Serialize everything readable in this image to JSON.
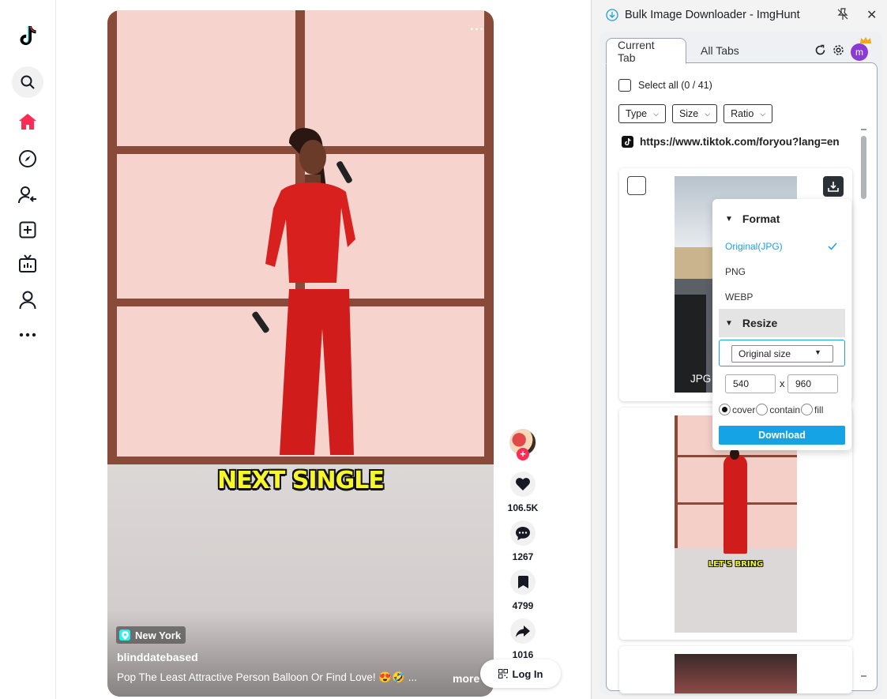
{
  "nav": {
    "items": [
      {
        "name": "tiktok-logo-icon"
      },
      {
        "name": "search-icon"
      },
      {
        "name": "home-icon"
      },
      {
        "name": "explore-icon"
      },
      {
        "name": "following-icon"
      },
      {
        "name": "upload-icon"
      },
      {
        "name": "live-icon"
      },
      {
        "name": "profile-icon"
      },
      {
        "name": "more-icon"
      }
    ],
    "accent": "#fe2c55"
  },
  "video": {
    "caption": "NEXT SINGLE",
    "location": "New York",
    "author": "blinddatebased",
    "description": "Pop The Least Attractive Person Balloon Or Find Love! 😍🤣 ...",
    "more_label": "more",
    "menu_glyph": "···"
  },
  "actions": {
    "likes": "106.5K",
    "comments": "1267",
    "saves": "4799",
    "shares": "1016"
  },
  "login": {
    "label": "Log In"
  },
  "extension": {
    "title": "Bulk Image Downloader - ImgHunt",
    "tabs": [
      "Current Tab",
      "All Tabs"
    ],
    "user_initial": "m",
    "select_all": "Select all (0 / 41)",
    "filters": [
      "Type",
      "Size",
      "Ratio"
    ],
    "url": "https://www.tiktok.com/foryou?lang=en",
    "image_type": "JPG",
    "thumb2_caption": "LET'S BRING",
    "popup": {
      "format_label": "Format",
      "formats": [
        "Original(JPG)",
        "PNG",
        "WEBP"
      ],
      "selected_format": "Original(JPG)",
      "resize_label": "Resize",
      "size_option": "Original size",
      "width": "540",
      "height": "960",
      "x_sep": "x",
      "fit_options": [
        "cover",
        "contain",
        "fill"
      ],
      "selected_fit": "cover",
      "download_label": "Download"
    },
    "accent": "#16a3e6"
  }
}
